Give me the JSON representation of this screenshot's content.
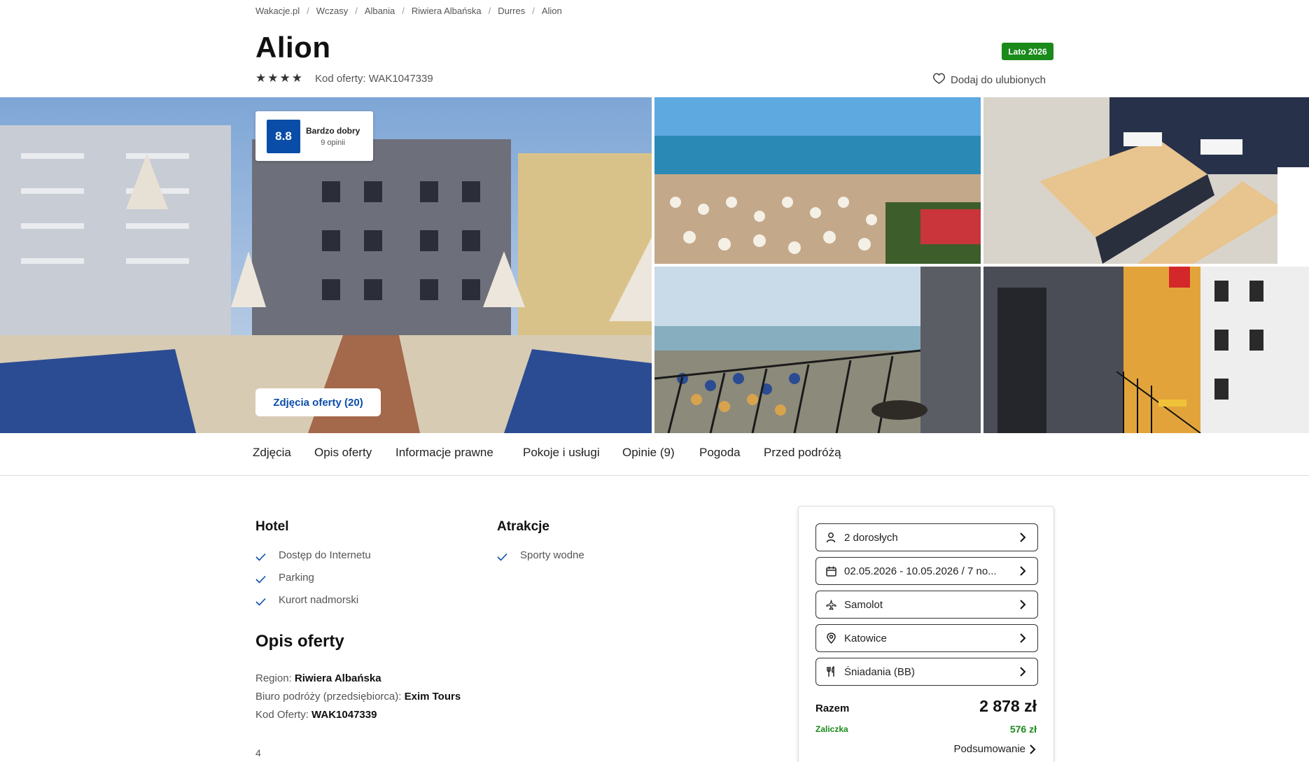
{
  "breadcrumb": [
    "Wakacje.pl",
    "Wczasy",
    "Albania",
    "Riwiera Albańska",
    "Durres",
    "Alion"
  ],
  "hotel": {
    "name": "Alion",
    "stars": 4,
    "offer_code_label": "Kod oferty: WAK1047339",
    "season_badge": "Lato 2026",
    "favorite_label": "Dodaj do ulubionych"
  },
  "rating": {
    "score": "8.8",
    "label": "Bardzo dobry",
    "count": "9 opinii"
  },
  "gallery": {
    "photos_button": "Zdjęcia oferty (20)"
  },
  "tabs": [
    {
      "label": "Zdjęcia"
    },
    {
      "label": "Opis oferty"
    },
    {
      "label": "Informacje prawne"
    },
    {
      "label": "Pokoje i usługi"
    },
    {
      "label": "Opinie (9)"
    },
    {
      "label": "Pogoda"
    },
    {
      "label": "Przed podróżą"
    }
  ],
  "amenities": {
    "hotel": {
      "heading": "Hotel",
      "items": [
        "Dostęp do Internetu",
        "Parking",
        "Kurort nadmorski"
      ]
    },
    "attractions": {
      "heading": "Atrakcje",
      "items": [
        "Sporty wodne"
      ]
    }
  },
  "description": {
    "heading": "Opis oferty",
    "region_label": "Region: ",
    "region_value": "Riwiera Albańska",
    "agency_label": "Biuro podróży (przedsiębiorca): ",
    "agency_value": "Exim Tours",
    "code_label": "Kod Oferty: ",
    "code_value": "WAK1047339",
    "trailing": "4"
  },
  "booking": {
    "travelers": "2 dorosłych",
    "dates": "02.05.2026 - 10.05.2026 / 7 no...",
    "transport": "Samolot",
    "departure": "Katowice",
    "board": "Śniadania (BB)",
    "total_label": "Razem",
    "total_price": "2 878 zł",
    "deposit_label": "Zaliczka",
    "deposit_price": "576 zł",
    "summary_label": "Podsumowanie"
  },
  "colors": {
    "brand_blue": "#0a4da8",
    "badge_green": "#1a8a1a",
    "text_dark": "#111111"
  }
}
